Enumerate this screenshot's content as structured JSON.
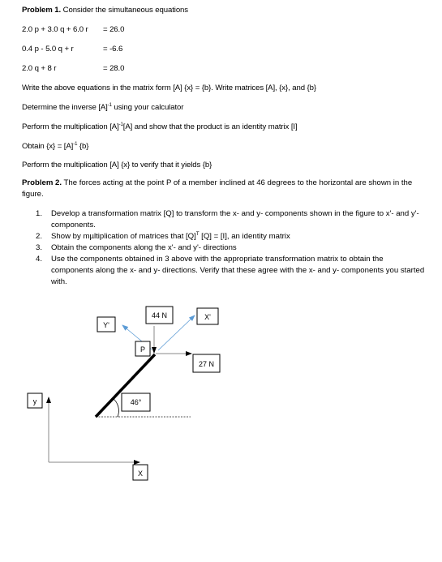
{
  "problem1": {
    "heading_bold": "Problem 1.",
    "heading_rest": " Consider the simultaneous equations",
    "equations": [
      {
        "lhs": "2.0 p  + 3.0 q  + 6.0 r",
        "rhs": "=  26.0"
      },
      {
        "lhs": "0.4 p  -  5.0 q  + r",
        "rhs": "= -6.6"
      },
      {
        "lhs": "2.0 q  + 8 r",
        "rhs": "= 28.0"
      }
    ],
    "steps": {
      "write_matrix": "Write the above equations in the matrix form [A] {x} = {b}. Write matrices [A], {x}, and {b}",
      "inverse_pre": "Determine the inverse [A]",
      "inverse_sup": "-1",
      "inverse_post": " using your calculator",
      "multiply_pre": "Perform the multiplication [A]",
      "multiply_sup": "-1",
      "multiply_post": "[A] and show that the product is an identity matrix [I]",
      "obtain_pre": "Obtain {x} = [A]",
      "obtain_sup": "-1",
      "obtain_post": " {b}",
      "verify": "Perform the multiplication [A] {x} to verify that it yields {b}"
    }
  },
  "problem2": {
    "heading_bold": "Problem 2.",
    "heading_rest": " The forces acting at the point P of a member inclined at 46 degrees to the horizontal are shown in the figure.",
    "items": [
      {
        "num": "1.",
        "text": "Develop a transformation matrix [Q] to transform the x- and y- components shown in the figure to x'- and y'-components."
      },
      {
        "num": "2.",
        "pre": "Show by mµltiplication of matrices that [Q]",
        "sup": "T",
        "post": " [Q] = [I], an identity matrix"
      },
      {
        "num": "3.",
        "text": "Obtain the components along the x'- and y'- directions"
      },
      {
        "num": "4.",
        "text": "Use the components obtained in 3 above with the appropriate transformation matrix to obtain the components along the x- and y- directions. Verify that these agree with the x- and y- components you started with."
      }
    ]
  },
  "figure": {
    "labels": {
      "y_prime": "Y'",
      "x_prime": "X'",
      "force_vertical": "44 N",
      "force_horizontal": "27 N",
      "point": "P",
      "angle": "46°",
      "y_axis": "y",
      "x_axis": "X"
    },
    "member_angle_deg": 46,
    "colors": {
      "prime_axes": "#5b9bd5",
      "force_arrows": "#808080",
      "member": "#000000"
    }
  }
}
